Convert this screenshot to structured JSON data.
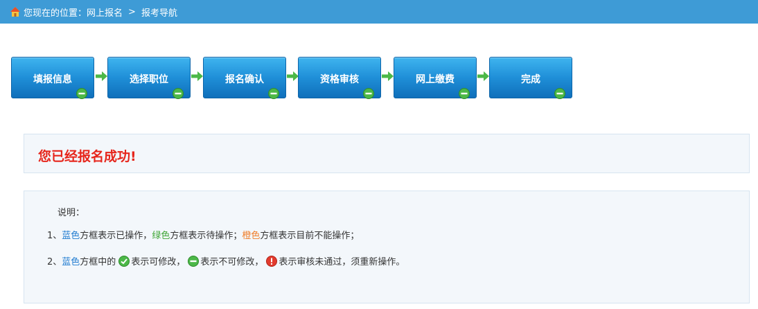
{
  "breadcrumb": {
    "prefix": "您现在的位置：",
    "items": [
      "网上报名",
      "报考导航"
    ],
    "separator": ">"
  },
  "steps": [
    {
      "label": "填报信息",
      "status": "not-editable"
    },
    {
      "label": "选择职位",
      "status": "not-editable"
    },
    {
      "label": "报名确认",
      "status": "not-editable"
    },
    {
      "label": "资格审核",
      "status": "not-editable"
    },
    {
      "label": "网上缴费",
      "status": "not-editable"
    },
    {
      "label": "完成",
      "status": "not-editable"
    }
  ],
  "success": {
    "message": "您已经报名成功!"
  },
  "notes": {
    "title": "说明：",
    "line1": {
      "num": "1、",
      "blue_word": "蓝色",
      "text_a": "方框表示已操作，",
      "green_word": "绿色",
      "text_b": "方框表示待操作；",
      "orange_word": "橙色",
      "text_c": "方框表示目前不能操作；"
    },
    "line2": {
      "num": "2、",
      "blue_word": "蓝色",
      "text_a": "方框中的",
      "text_b": "表示可修改，",
      "text_c": "表示不可修改，",
      "text_d": "表示审核未通过，须重新操作。"
    }
  },
  "colors": {
    "topbar": "#3e9bd6",
    "step_blue": "#1f8fd8",
    "success_red": "#e6261c",
    "legend_blue": "#1f7bd0",
    "legend_green": "#3da534",
    "legend_orange": "#f07d28"
  }
}
